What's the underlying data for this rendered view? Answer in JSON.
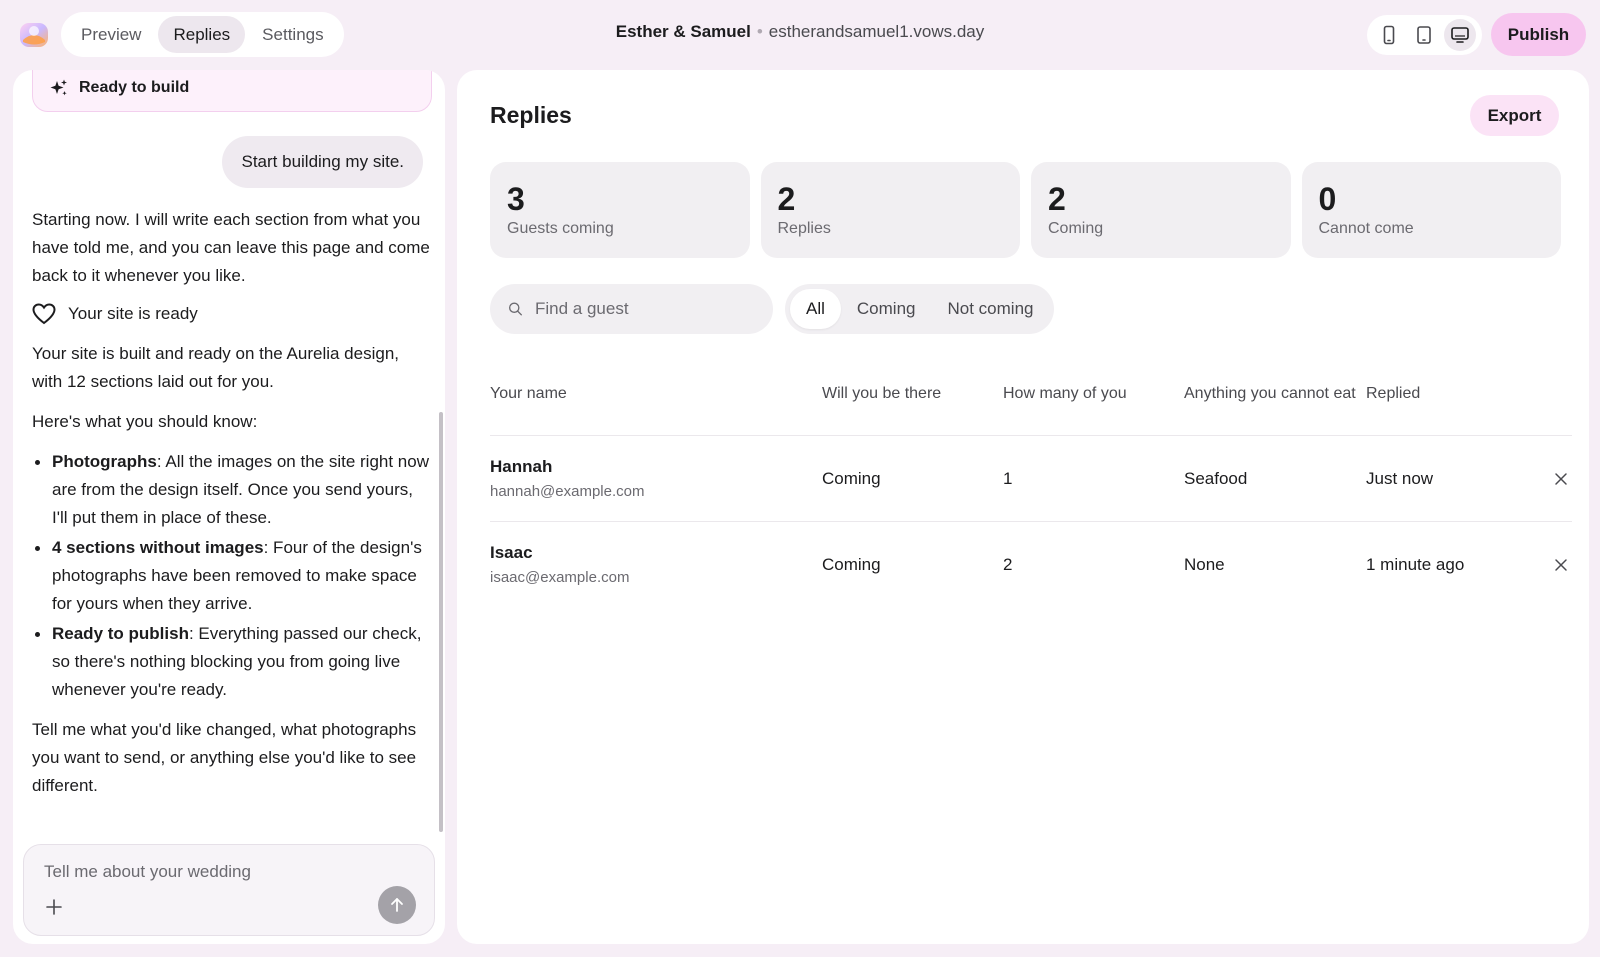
{
  "topbar": {
    "tabs": [
      {
        "label": "Preview",
        "active": false
      },
      {
        "label": "Replies",
        "active": true
      },
      {
        "label": "Settings",
        "active": false
      }
    ],
    "couple": "Esther & Samuel",
    "separator": "•",
    "domain": "estherandsamuel1.vows.day",
    "devices": [
      "phone-icon",
      "tablet-icon",
      "desktop-icon"
    ],
    "active_device": "desktop-icon",
    "publish_label": "Publish"
  },
  "chat": {
    "ready_card": "Ready to build",
    "user_message": "Start building my site.",
    "intro": "Starting now. I will write each section from what you have told me, and you can leave this page and come back to it whenever you like.",
    "status": "Your site is ready",
    "built": "Your site is built and ready on the Aurelia design, with 12 sections laid out for you.",
    "know": "Here's what you should know:",
    "bullets": [
      {
        "title": "Photographs",
        "text": ": All the images on the site right now are from the design itself. Once you send yours, I'll put them in place of these."
      },
      {
        "title": "4 sections without images",
        "text": ": Four of the design's photographs have been removed to make space for yours when they arrive."
      },
      {
        "title": "Ready to publish",
        "text": ": Everything passed our check, so there's nothing blocking you from going live whenever you're ready."
      }
    ],
    "closing": "Tell me what you'd like changed, what photographs you want to send, or anything else you'd like to see different.",
    "composer_placeholder": "Tell me about your wedding"
  },
  "replies": {
    "title": "Replies",
    "export_label": "Export",
    "stats": [
      {
        "value": "3",
        "label": "Guests coming"
      },
      {
        "value": "2",
        "label": "Replies"
      },
      {
        "value": "2",
        "label": "Coming"
      },
      {
        "value": "0",
        "label": "Cannot come"
      }
    ],
    "search_placeholder": "Find a guest",
    "filters": [
      {
        "label": "All",
        "active": true
      },
      {
        "label": "Coming",
        "active": false
      },
      {
        "label": "Not coming",
        "active": false
      }
    ],
    "columns": [
      "Your name",
      "Will you be there",
      "How many of you",
      "Anything you cannot eat",
      "Replied"
    ],
    "rows": [
      {
        "name": "Hannah",
        "email": "hannah@example.com",
        "there": "Coming",
        "count": "1",
        "eat": "Seafood",
        "replied": "Just now"
      },
      {
        "name": "Isaac",
        "email": "isaac@example.com",
        "there": "Coming",
        "count": "2",
        "eat": "None",
        "replied": "1 minute ago"
      }
    ]
  },
  "colors": {
    "background": "#f6eef6",
    "publish": "#f7c6ef",
    "export": "#fbe3f6",
    "card": "#f1eff2"
  }
}
